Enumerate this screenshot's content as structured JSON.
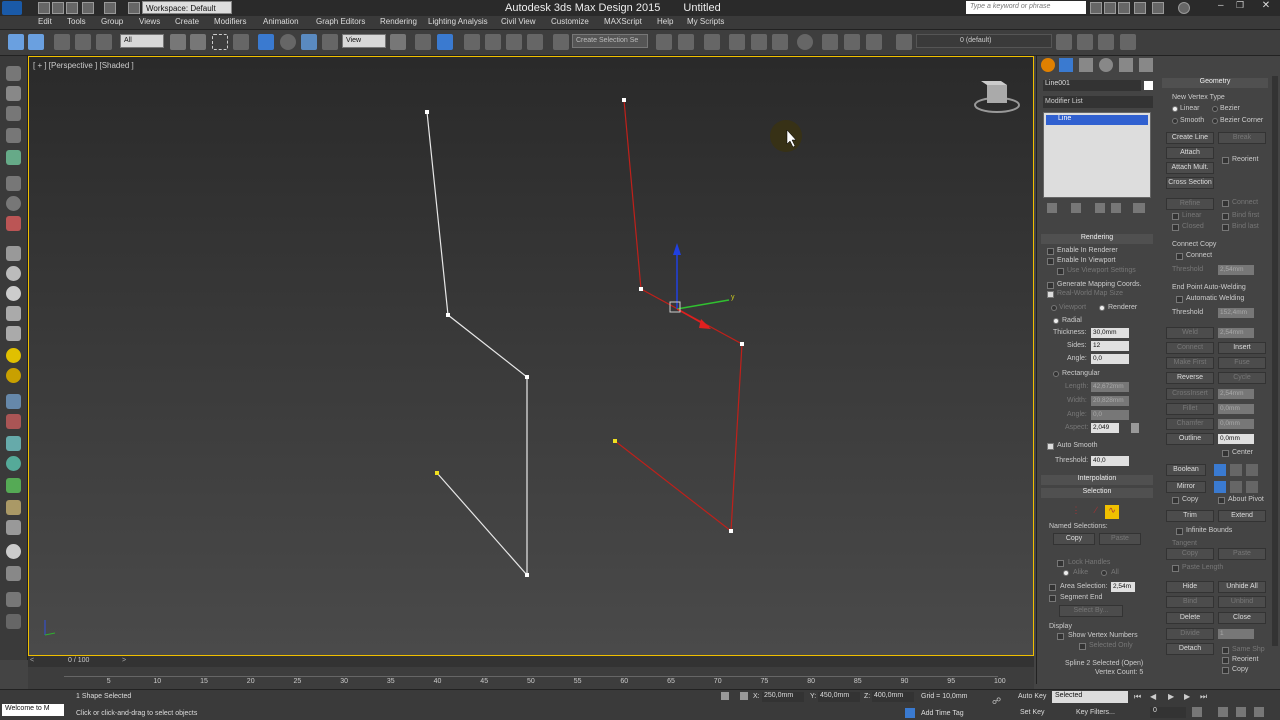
{
  "window": {
    "title": "Autodesk 3ds Max Design 2015",
    "doc": "Untitled",
    "workspace": "Workspace: Default",
    "search_placeholder": "Type a keyword or phrase"
  },
  "menu": [
    "Edit",
    "Tools",
    "Group",
    "Views",
    "Create",
    "Modifiers",
    "Animation",
    "Graph Editors",
    "Rendering",
    "Lighting Analysis",
    "Civil View",
    "Customize",
    "MAXScript",
    "Help",
    "My Scripts"
  ],
  "toolbar": {
    "selection_filter": "All",
    "ref_coord": "View",
    "named_sel": "Create Selection Se",
    "layer": "0 (default)"
  },
  "viewport": {
    "label": "[ + ] [Perspective ] [Shaded ]"
  },
  "timeline": {
    "frame": "0 / 100",
    "ticks": [
      "5",
      "10",
      "15",
      "20",
      "25",
      "30",
      "35",
      "40",
      "45",
      "50",
      "55",
      "60",
      "65",
      "70",
      "75",
      "80",
      "85",
      "90",
      "95",
      "100"
    ]
  },
  "status": {
    "maxscript": "Welcome to M",
    "selected": "1 Shape Selected",
    "prompt": "Click or click-and-drag to select objects",
    "x": "250,0mm",
    "y": "450,0mm",
    "z": "400,0mm",
    "grid": "Grid = 10,0mm",
    "auto_key": "Auto Key",
    "set_key": "Set Key",
    "key_mode": "Selected",
    "key_filters": "Key Filters...",
    "add_time_tag": "Add Time Tag",
    "frame_field": "0"
  },
  "cmd": {
    "object_name": "Line001",
    "modifier_list": "Modifier List",
    "stack_item": "Line",
    "rendering": {
      "head": "Rendering",
      "enable_renderer": "Enable In Renderer",
      "enable_viewport": "Enable In Viewport",
      "use_vp_settings": "Use Viewport Settings",
      "gen_mapping": "Generate Mapping Coords.",
      "real_world": "Real-World Map Size",
      "viewport": "Viewport",
      "renderer": "Renderer",
      "radial": "Radial",
      "thickness_lbl": "Thickness:",
      "thickness": "30,0mm",
      "sides_lbl": "Sides:",
      "sides": "12",
      "angle_lbl": "Angle:",
      "angle": "0,0",
      "rectangular": "Rectangular",
      "length_lbl": "Length:",
      "length": "42,672mm",
      "width_lbl": "Width:",
      "width": "20,828mm",
      "angle2_lbl": "Angle:",
      "angle2": "0,0",
      "aspect_lbl": "Aspect:",
      "aspect": "2,049",
      "auto_smooth": "Auto Smooth",
      "threshold_lbl": "Threshold:",
      "threshold": "40,0"
    },
    "interpolation": "Interpolation",
    "selection": {
      "head": "Selection",
      "named": "Named Selections:",
      "copy": "Copy",
      "paste": "Paste",
      "lock_handles": "Lock Handles",
      "alike": "Alike",
      "all": "All",
      "area_sel": "Area Selection:",
      "area_val": "2,54m",
      "segment_end": "Segment End",
      "select_by": "Select By...",
      "display": "Display",
      "show_vertex": "Show Vertex Numbers",
      "selected_only": "Selected Only",
      "info1": "Spline 2 Selected (Open)",
      "info2": "Vertex Count: 5"
    }
  },
  "geometry": {
    "head": "Geometry",
    "new_vertex_type": "New Vertex Type",
    "linear": "Linear",
    "bezier": "Bezier",
    "smooth": "Smooth",
    "bezier_corner": "Bezier Corner",
    "create_line": "Create Line",
    "break": "Break",
    "attach": "Attach",
    "reorient": "Reorient",
    "attach_mult": "Attach Mult.",
    "cross_section": "Cross Section",
    "refine": "Refine",
    "connect": "Connect",
    "linear2": "Linear",
    "bind_first": "Bind first",
    "closed": "Closed",
    "bind_last": "Bind last",
    "connect_copy": "Connect Copy",
    "connect2": "Connect",
    "threshold_lbl": "Threshold",
    "threshold": "2,54mm",
    "endpoint_welding": "End Point Auto-Welding",
    "automatic_welding": "Automatic Welding",
    "threshold2_lbl": "Threshold",
    "threshold2": "152,4mm",
    "weld": "Weld",
    "weld_val": "2,54mm",
    "connect3": "Connect",
    "insert": "Insert",
    "make_first": "Make First",
    "fuse": "Fuse",
    "reverse": "Reverse",
    "cycle": "Cycle",
    "crossinsert": "CrossInsert",
    "crossinsert_val": "2,54mm",
    "fillet": "Fillet",
    "fillet_val": "0,0mm",
    "chamfer": "Chamfer",
    "chamfer_val": "0,0mm",
    "outline": "Outline",
    "outline_val": "0,0mm",
    "center": "Center",
    "boolean": "Boolean",
    "mirror": "Mirror",
    "copy": "Copy",
    "about_pivot": "About Pivot",
    "trim": "Trim",
    "extend": "Extend",
    "infinite_bounds": "Infinite Bounds",
    "tangent": "Tangent",
    "copy2": "Copy",
    "paste2": "Paste",
    "paste_length": "Paste Length",
    "hide": "Hide",
    "unhide_all": "Unhide All",
    "bind": "Bind",
    "unbind": "Unbind",
    "delete": "Delete",
    "close": "Close",
    "divide": "Divide",
    "divide_val": "1",
    "detach": "Detach",
    "same_shp": "Same Shp",
    "reorient2": "Reorient",
    "copy3": "Copy"
  },
  "colors": {
    "viewport_border": "#f0c000",
    "white_line": "#e8e8e8",
    "red_line": "#c0201a",
    "selected_vertex": "#f0e020",
    "stack_selected": "#3060d0"
  }
}
